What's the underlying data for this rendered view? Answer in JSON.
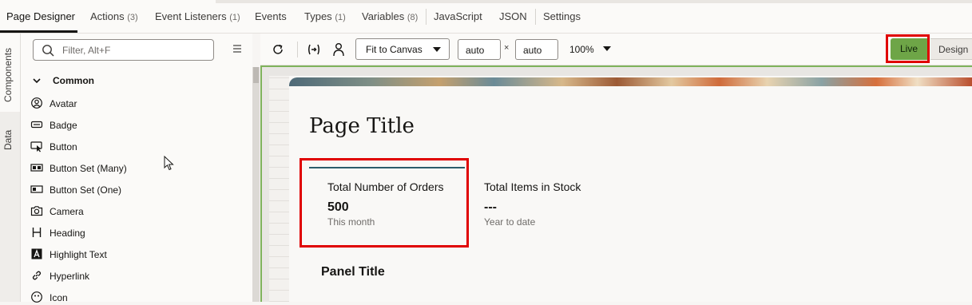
{
  "top_tabs": {
    "page_designer": "Page Designer",
    "actions": "Actions",
    "actions_count": "(3)",
    "event_listeners": "Event Listeners",
    "event_listeners_count": "(1)",
    "events": "Events",
    "types": "Types",
    "types_count": "(1)",
    "variables": "Variables",
    "variables_count": "(8)",
    "javascript": "JavaScript",
    "json": "JSON",
    "settings": "Settings"
  },
  "side_tabs": {
    "components": "Components",
    "data": "Data"
  },
  "components_panel": {
    "search_placeholder": "Filter, Alt+F",
    "section": "Common",
    "items": [
      {
        "label": "Avatar",
        "icon": "avatar-icon"
      },
      {
        "label": "Badge",
        "icon": "badge-icon"
      },
      {
        "label": "Button",
        "icon": "button-icon"
      },
      {
        "label": "Button Set (Many)",
        "icon": "button-set-many-icon"
      },
      {
        "label": "Button Set (One)",
        "icon": "button-set-one-icon"
      },
      {
        "label": "Camera",
        "icon": "camera-icon"
      },
      {
        "label": "Heading",
        "icon": "heading-icon"
      },
      {
        "label": "Highlight Text",
        "icon": "highlight-text-icon"
      },
      {
        "label": "Hyperlink",
        "icon": "hyperlink-icon"
      },
      {
        "label": "Icon",
        "icon": "icon-icon"
      }
    ]
  },
  "canvas_toolbar": {
    "fit_select": "Fit to Canvas",
    "width": "auto",
    "times": "×",
    "height": "auto",
    "zoom": "100%",
    "live": "Live",
    "design": "Design"
  },
  "canvas": {
    "page_title": "Page Title",
    "cards": [
      {
        "title": "Total Number of Orders",
        "value": "500",
        "subtitle": "This month"
      },
      {
        "title": "Total Items in Stock",
        "value": "---",
        "subtitle": "Year to date"
      }
    ],
    "panel_title": "Panel Title"
  },
  "colors": {
    "live_button": "#6ea547",
    "highlight": "#e00000",
    "card_accent": "#2b5c6b"
  }
}
